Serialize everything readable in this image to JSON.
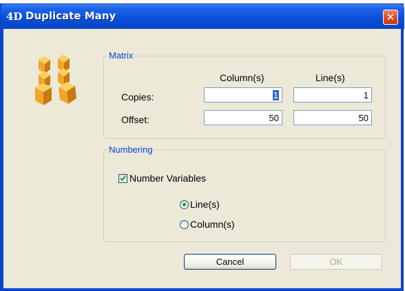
{
  "window": {
    "title": "Duplicate Many",
    "app_logo": "4D",
    "close_symbol": "✕"
  },
  "matrix": {
    "legend": "Matrix",
    "column_header": "Column(s)",
    "line_header": "Line(s)",
    "copies_label": "Copies:",
    "offset_label": "Offset:",
    "copies_column": "1",
    "copies_line": "1",
    "offset_column": "50",
    "offset_line": "50"
  },
  "numbering": {
    "legend": "Numbering",
    "number_variables_label": "Number Variables",
    "number_variables_checked": true,
    "radio_options": [
      {
        "label": "Line(s)",
        "selected": true
      },
      {
        "label": "Column(s)",
        "selected": false
      }
    ]
  },
  "buttons": {
    "cancel": "Cancel",
    "ok": "OK",
    "ok_enabled": false
  },
  "colors": {
    "titlebar": "#0a50dc",
    "dialog_bg": "#ece9d8",
    "group_legend": "#0046d5",
    "close_button": "#d9491f",
    "check_green": "#21a121"
  },
  "icons": {
    "title_logo": "4d-logo-icon",
    "close": "close-icon",
    "illustration": "duplicate-cubes-icon"
  }
}
